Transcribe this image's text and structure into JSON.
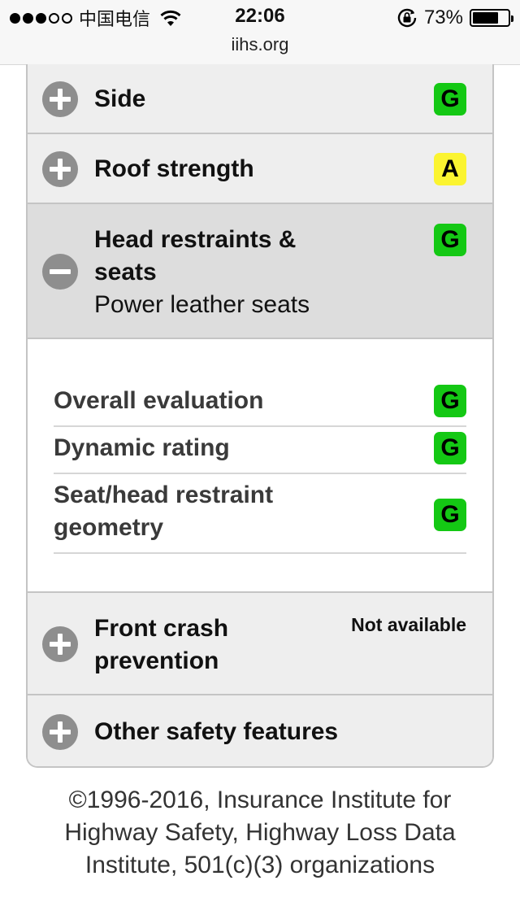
{
  "status_bar": {
    "carrier": "中国电信",
    "time": "22:06",
    "battery": "73%",
    "battery_level": 0.73,
    "url": "iihs.org",
    "icons": [
      "signal-dots",
      "wifi-icon",
      "rotation-lock-icon",
      "battery-icon"
    ]
  },
  "ratings": [
    {
      "label": "Side",
      "rating": "G",
      "state": "collapsed"
    },
    {
      "label": "Roof strength",
      "rating": "A",
      "state": "collapsed"
    },
    {
      "label": "Head restraints & seats",
      "label_line1": "Head restraints &",
      "label_line2": "seats",
      "sublabel": "Power leather seats",
      "rating": "G",
      "state": "expanded"
    },
    {
      "label": "Front crash prevention",
      "label_line1": "Front crash",
      "label_line2": "prevention",
      "rating_text": "Not available",
      "state": "collapsed"
    },
    {
      "label": "Other safety features",
      "state": "collapsed"
    }
  ],
  "details": [
    {
      "label": "Overall evaluation",
      "rating": "G"
    },
    {
      "label": "Dynamic rating",
      "rating": "G"
    },
    {
      "label": "Seat/head restraint geometry",
      "label_line1": "Seat/head restraint",
      "label_line2": "geometry",
      "rating": "G"
    }
  ],
  "footer": {
    "line1": "©1996-2016, Insurance Institute for",
    "line2": "Highway Safety, Highway Loss Data",
    "line3": "Institute, 501(c)(3) organizations"
  },
  "colors": {
    "rating_good": "#14c814",
    "rating_acceptable": "#fbf430",
    "row_background": "#eeeeee",
    "row_expanded_background": "#dddddd",
    "toggle_icon": "#8e8e8e"
  }
}
